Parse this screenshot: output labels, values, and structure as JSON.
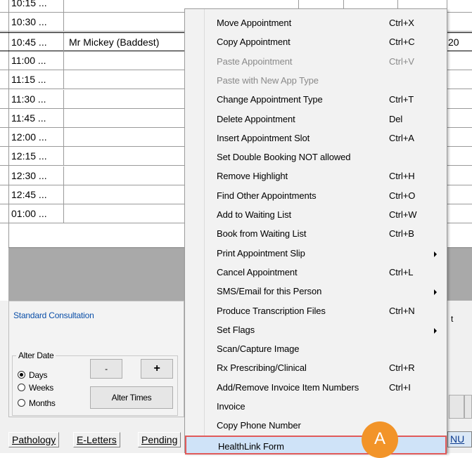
{
  "schedule": {
    "times": [
      "10:15 ...",
      "10:30 ...",
      "10:45 ...",
      "11:00 ...",
      "11:15 ...",
      "11:30 ...",
      "11:45 ...",
      "12:00 ...",
      "12:15 ...",
      "12:30 ...",
      "12:45 ...",
      "01:00 ..."
    ],
    "selected_patient": "Mr Mickey (Baddest)",
    "right_fragment": "20"
  },
  "lower_panel": {
    "appointment_type": "Standard Consultation",
    "right_fragment": "t",
    "alter_date": {
      "legend": "Alter Date",
      "options": [
        "Days",
        "Weeks",
        "Months"
      ],
      "selected": "Days",
      "minus_label": "-",
      "plus_label": "+",
      "alter_times_label": "Alter Times"
    }
  },
  "tabs": [
    "Pathology",
    "E-Letters",
    "Pending"
  ],
  "right_tab_fragment": "NU",
  "context_menu": {
    "items": [
      {
        "label": "Move Appointment",
        "shortcut": "Ctrl+X",
        "disabled": false,
        "submenu": false
      },
      {
        "label": "Copy Appointment",
        "shortcut": "Ctrl+C",
        "disabled": false,
        "submenu": false
      },
      {
        "label": "Paste Appointment",
        "shortcut": "Ctrl+V",
        "disabled": true,
        "submenu": false
      },
      {
        "label": "Paste with New App Type",
        "shortcut": "",
        "disabled": true,
        "submenu": false
      },
      {
        "label": "Change Appointment Type",
        "shortcut": "Ctrl+T",
        "disabled": false,
        "submenu": false
      },
      {
        "label": "Delete Appointment",
        "shortcut": "Del",
        "disabled": false,
        "submenu": false
      },
      {
        "label": "Insert Appointment Slot",
        "shortcut": "Ctrl+A",
        "disabled": false,
        "submenu": false
      },
      {
        "label": "Set Double Booking NOT allowed",
        "shortcut": "",
        "disabled": false,
        "submenu": false
      },
      {
        "label": "Remove Highlight",
        "shortcut": "Ctrl+H",
        "disabled": false,
        "submenu": false
      },
      {
        "label": "Find Other Appointments",
        "shortcut": "Ctrl+O",
        "disabled": false,
        "submenu": false
      },
      {
        "label": "Add to Waiting List",
        "shortcut": "Ctrl+W",
        "disabled": false,
        "submenu": false
      },
      {
        "label": "Book from Waiting List",
        "shortcut": "Ctrl+B",
        "disabled": false,
        "submenu": false
      },
      {
        "label": "Print Appointment Slip",
        "shortcut": "",
        "disabled": false,
        "submenu": true
      },
      {
        "label": "Cancel Appointment",
        "shortcut": "Ctrl+L",
        "disabled": false,
        "submenu": false
      },
      {
        "label": "SMS/Email for this Person",
        "shortcut": "",
        "disabled": false,
        "submenu": true
      },
      {
        "label": "Produce Transcription Files",
        "shortcut": "Ctrl+N",
        "disabled": false,
        "submenu": false
      },
      {
        "label": "Set Flags",
        "shortcut": "",
        "disabled": false,
        "submenu": true
      },
      {
        "label": "Scan/Capture Image",
        "shortcut": "",
        "disabled": false,
        "submenu": false
      },
      {
        "label": "Rx Prescribing/Clinical",
        "shortcut": "Ctrl+R",
        "disabled": false,
        "submenu": false
      },
      {
        "label": "Add/Remove Invoice Item Numbers",
        "shortcut": "Ctrl+I",
        "disabled": false,
        "submenu": false
      },
      {
        "label": "Invoice",
        "shortcut": "",
        "disabled": false,
        "submenu": false
      },
      {
        "label": "Copy Phone Number",
        "shortcut": "",
        "disabled": false,
        "submenu": false
      },
      {
        "label": "HealthLink Form",
        "shortcut": "",
        "disabled": false,
        "submenu": false,
        "highlighted": true
      }
    ]
  },
  "annotation_badge": "A",
  "colors": {
    "menu_highlight_border": "#e15b5b",
    "menu_highlight_fill": "#cfe3f8",
    "badge": "#f29429",
    "link_blue": "#0b4fa8"
  }
}
